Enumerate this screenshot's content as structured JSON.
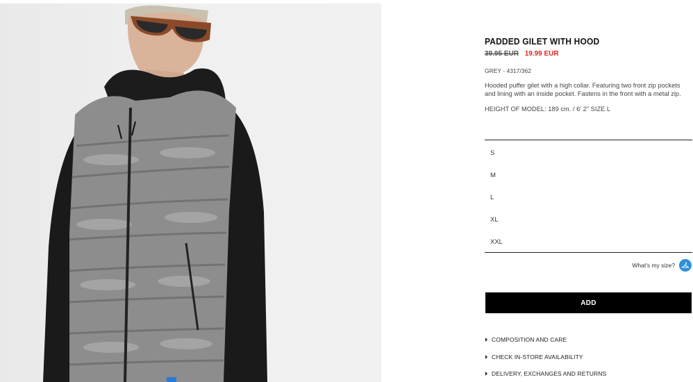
{
  "product": {
    "title": "PADDED GILET WITH HOOD",
    "old_price": "39.95 EUR",
    "new_price": "19.99 EUR",
    "color_ref": "GREY - 4317/362",
    "description": "Hooded puffer gilet with a high collar. Featuring two front zip pockets and lining with an inside pocket. Fastens in the front with a metal zip.",
    "model_info": "HEIGHT OF MODEL: 189 cm. / 6' 2\" SIZE L"
  },
  "sizes": [
    "S",
    "M",
    "L",
    "XL",
    "XXL"
  ],
  "size_guide": {
    "label": "What's my size?",
    "icon": "hanger-icon"
  },
  "add_button": {
    "label": "ADD"
  },
  "links": [
    {
      "label": "COMPOSITION AND CARE"
    },
    {
      "label": "CHECK IN-STORE AVAILABILITY"
    },
    {
      "label": "DELIVERY, EXCHANGES AND RETURNS"
    }
  ],
  "colors": {
    "accent": "#2f8fd8",
    "sale": "#e1251b",
    "button_bg": "#000000"
  }
}
